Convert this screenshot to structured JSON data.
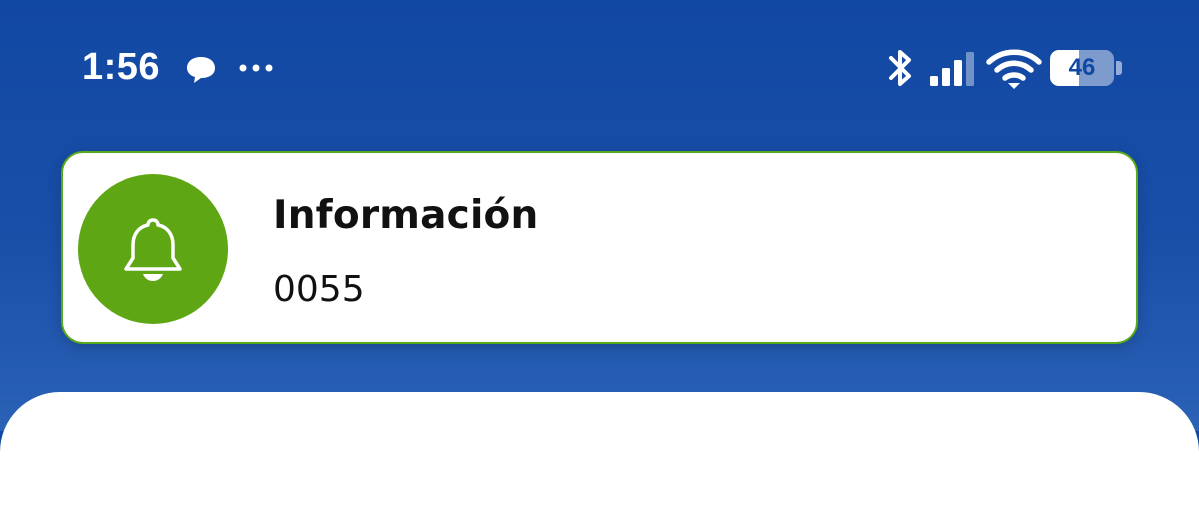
{
  "status_bar": {
    "time": "1:56",
    "battery_level": "46",
    "battery_fraction": 0.46,
    "icons": [
      "chat-bubble-icon",
      "more-dots-icon",
      "bluetooth-icon",
      "cellular-signal-icon",
      "wifi-icon",
      "battery-icon"
    ]
  },
  "notification": {
    "title": "Información",
    "body": "0055",
    "icon": "bell-icon",
    "accent_color": "#5ea614"
  },
  "colors": {
    "background": "#1148a3",
    "card": "#ffffff",
    "card_border": "#5aa91a"
  }
}
